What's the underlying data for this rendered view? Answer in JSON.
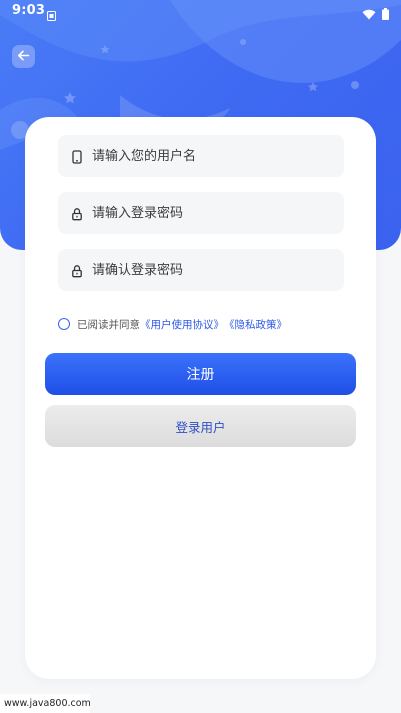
{
  "status_bar": {
    "time": "9:03"
  },
  "icons": {
    "back": "arrow-left-icon",
    "username": "phone-icon",
    "password": "lock-icon",
    "confirm_password": "lock-icon",
    "wifi": "wifi-icon",
    "battery": "battery-icon",
    "sim": "sim-card-icon"
  },
  "form": {
    "username_placeholder": "请输入您的用户名",
    "username_value": "",
    "password_placeholder": "请输入登录密码",
    "password_value": "",
    "confirm_placeholder": "请确认登录密码",
    "confirm_value": ""
  },
  "agreement": {
    "checked": false,
    "prefix": "已阅读并同意",
    "user_agreement": "《用户使用协议》",
    "privacy_policy": "《隐私政策》"
  },
  "buttons": {
    "register": "注册",
    "login": "登录用户"
  },
  "watermark": "www.java800.com",
  "colors": {
    "brand_blue": "#3f6bf3",
    "register_button": "#2a5df0",
    "link": "#2d58e8",
    "login_text": "#2e4fc4"
  }
}
